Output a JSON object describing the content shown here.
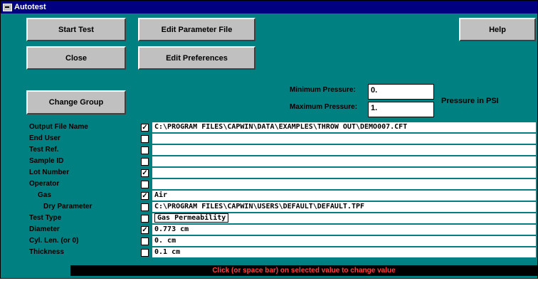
{
  "window": {
    "title": "Autotest"
  },
  "buttons": {
    "start_test": "Start Test",
    "edit_parameter_file": "Edit Parameter File",
    "help": "Help",
    "close": "Close",
    "edit_preferences": "Edit Preferences",
    "change_group": "Change Group"
  },
  "pressure": {
    "min_label": "Minimum Pressure:",
    "min_value": "0.",
    "max_label": "Maximum Pressure:",
    "max_value": "1.",
    "unit_note": "Pressure in PSI"
  },
  "fields": [
    {
      "label": "Output File Name",
      "checked": true,
      "value": "C:\\PROGRAM FILES\\CAPWIN\\DATA\\EXAMPLES\\THROW OUT\\DEMO007.CFT"
    },
    {
      "label": "End User",
      "checked": false,
      "value": ""
    },
    {
      "label": "Test Ref.",
      "checked": false,
      "value": ""
    },
    {
      "label": "Sample ID",
      "checked": false,
      "value": ""
    },
    {
      "label": "Lot Number",
      "checked": true,
      "value": ""
    },
    {
      "label": "Operator",
      "checked": false,
      "value": ""
    },
    {
      "label": "Gas",
      "checked": true,
      "value": "Air"
    },
    {
      "label": "Dry Parameter",
      "checked": false,
      "value": "C:\\PROGRAM FILES\\CAPWIN\\USERS\\DEFAULT\\DEFAULT.TPF"
    },
    {
      "label": "Test Type",
      "checked": false,
      "value": "Gas Permeability"
    },
    {
      "label": "Diameter",
      "checked": true,
      "value": "0.773 cm"
    },
    {
      "label": "Cyl. Len. (or 0)",
      "checked": false,
      "value": "0. cm"
    },
    {
      "label": "Thickness",
      "checked": false,
      "value": "0.1 cm"
    }
  ],
  "status": {
    "message": "Click (or space bar) on selected value to change value"
  },
  "colors": {
    "background": "#008080",
    "titlebar": "#000080",
    "status_text": "#ff4040"
  }
}
